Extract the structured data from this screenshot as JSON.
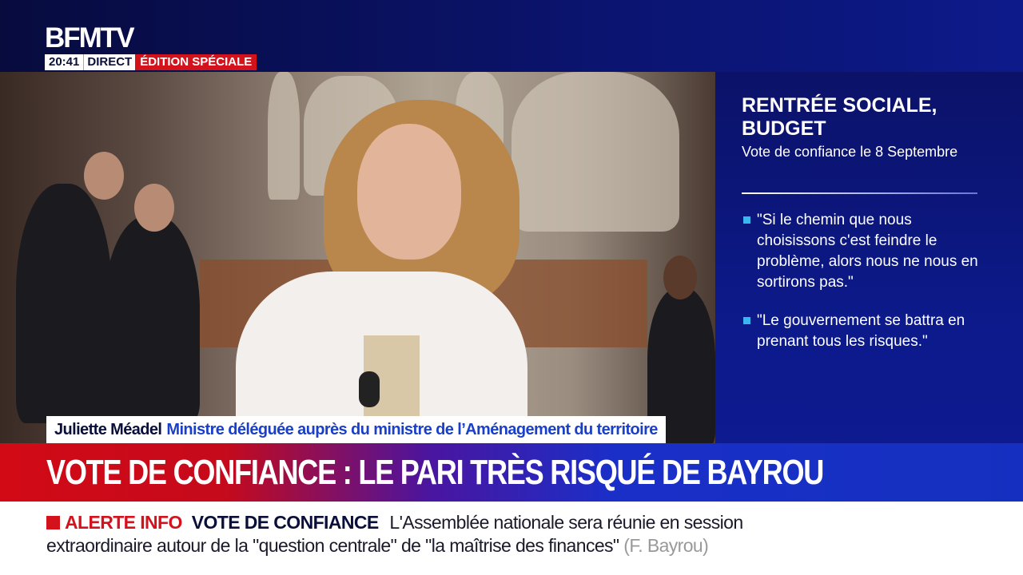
{
  "channel": {
    "logo": "BFMTV",
    "time": "20:41",
    "live_label": "DIRECT",
    "edition_label": "ÉDITION SPÉCIALE"
  },
  "panel": {
    "title": "RENTRÉE SOCIALE, BUDGET",
    "subtitle": "Vote de confiance le 8 Septembre",
    "quotes": [
      "\"Si le chemin que nous choisissons c'est feindre le problème, alors nous ne nous en sortirons pas.\"",
      "\"Le gouvernement se battra en prenant tous les risques.\""
    ]
  },
  "guest": {
    "name": "Juliette Méadel",
    "role": "Ministre déléguée auprès du ministre de l’Aménagement du territoire"
  },
  "headline": "VOTE DE CONFIANCE : LE PARI TRÈS RISQUÉ DE BAYROU",
  "ticker": {
    "alert_label": "ALERTE INFO",
    "topic": "VOTE DE CONFIANCE",
    "text": "L'Assemblée nationale sera réunie en session extraordinaire autour de la \"question centrale\" de \"la maîtrise des finances\"",
    "source": "(F. Bayrou)"
  },
  "colors": {
    "red": "#d3121c",
    "navy": "#0b1268",
    "blue": "#1530c0",
    "bullet": "#39b6f0"
  }
}
